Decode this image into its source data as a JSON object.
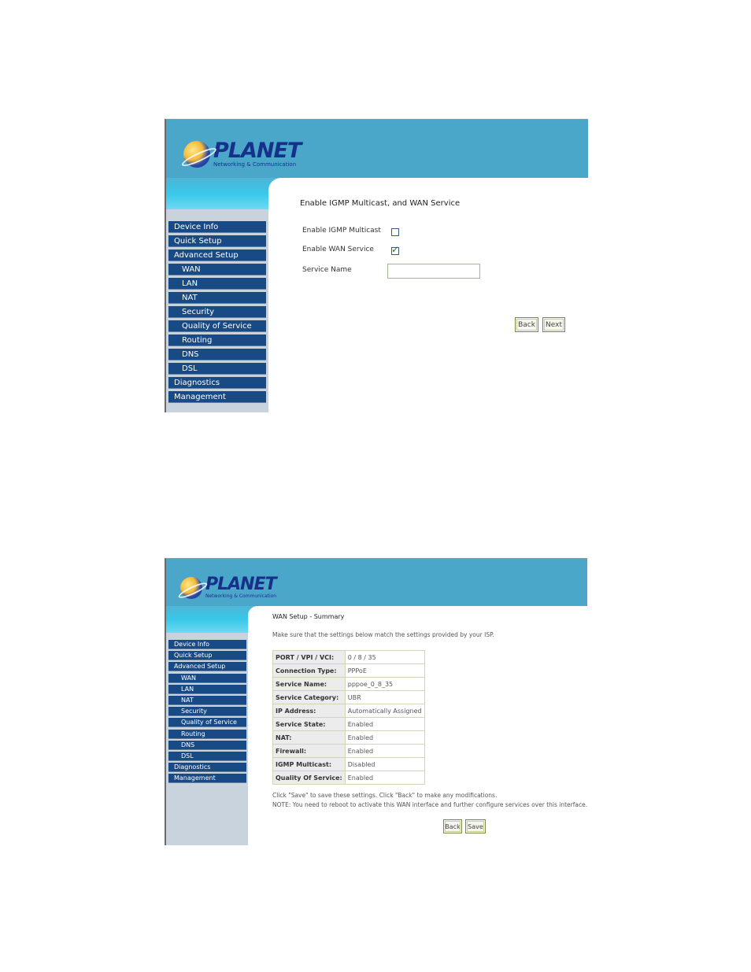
{
  "brand": {
    "name": "PLANET",
    "tagline": "Networking & Communication"
  },
  "menu": [
    {
      "label": "Device Info",
      "sub": false
    },
    {
      "label": "Quick Setup",
      "sub": false
    },
    {
      "label": "Advanced Setup",
      "sub": false
    },
    {
      "label": "WAN",
      "sub": true
    },
    {
      "label": "LAN",
      "sub": true
    },
    {
      "label": "NAT",
      "sub": true
    },
    {
      "label": "Security",
      "sub": true
    },
    {
      "label": "Quality of Service",
      "sub": true
    },
    {
      "label": "Routing",
      "sub": true
    },
    {
      "label": "DNS",
      "sub": true
    },
    {
      "label": "DSL",
      "sub": true
    },
    {
      "label": "Diagnostics",
      "sub": false
    },
    {
      "label": "Management",
      "sub": false
    }
  ],
  "igmp_page": {
    "title": "Enable IGMP Multicast, and WAN Service",
    "igmp_label": "Enable IGMP Multicast",
    "igmp_checked": false,
    "wan_label": "Enable WAN Service",
    "wan_checked": true,
    "service_name_label": "Service Name",
    "service_name_value": "",
    "back_label": "Back",
    "next_label": "Next"
  },
  "summary_page": {
    "title": "WAN Setup - Summary",
    "intro": "Make sure that the settings below match the settings provided by your ISP.",
    "rows": [
      {
        "key": "PORT / VPI / VCI:",
        "value": "0 / 8 / 35"
      },
      {
        "key": "Connection Type:",
        "value": "PPPoE"
      },
      {
        "key": "Service Name:",
        "value": "pppoe_0_8_35"
      },
      {
        "key": "Service Category:",
        "value": "UBR"
      },
      {
        "key": "IP Address:",
        "value": "Automatically Assigned"
      },
      {
        "key": "Service State:",
        "value": "Enabled"
      },
      {
        "key": "NAT:",
        "value": "Enabled"
      },
      {
        "key": "Firewall:",
        "value": "Enabled"
      },
      {
        "key": "IGMP Multicast:",
        "value": "Disabled"
      },
      {
        "key": "Quality Of Service:",
        "value": "Enabled"
      }
    ],
    "note1": "Click \"Save\" to save these settings. Click \"Back\" to make any modifications.",
    "note2": "NOTE: You need to reboot to activate this WAN interface and further configure services over this interface.",
    "back_label": "Back",
    "save_label": "Save"
  },
  "colors": {
    "header": "#4aa7ca",
    "menu_bg": "#184a86",
    "sidebar": "#c9d3dd"
  }
}
